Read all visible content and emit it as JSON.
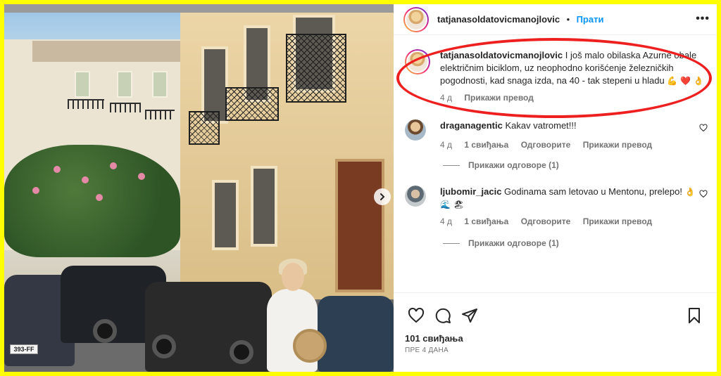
{
  "post": {
    "author": "tatjanasoldatovicmanojlovic",
    "separator": "•",
    "follow_label": "Прати",
    "more_label": "•••",
    "caption": "I još malo obilaska Azurne obale električnim biciklom, uz neophodno korišćenje železničkih pogodnosti, kad snaga izda, na 40 - tak stepeni u hladu",
    "caption_emojis": "💪 ❤️ 👌",
    "caption_age": "4 д",
    "caption_translate": "Прикажи превод",
    "license_plate": "393-FF"
  },
  "comments": [
    {
      "user": "draganagentic",
      "text": "Kakav vatromet!!!",
      "emojis": "",
      "age": "4 д",
      "likes": "1 свиђања",
      "reply": "Одговорите",
      "translate": "Прикажи превод",
      "view_replies": "Прикажи одговоре (1)"
    },
    {
      "user": "ljubomir_jacic",
      "text": "Godinama sam letovao u Mentonu, prelepo!",
      "emojis": "👌 🌊 🏖",
      "age": "4 д",
      "likes": "1 свиђања",
      "reply": "Одговорите",
      "translate": "Прикажи превод",
      "view_replies": "Прикажи одговоре (1)"
    }
  ],
  "footer": {
    "likes": "101 свиђања",
    "posted": "ПРЕ 4 ДАНА"
  },
  "colors": {
    "accent": "#0095f6",
    "frame": "#ffff00",
    "annotation": "#ee1f1f",
    "muted": "#737373"
  },
  "icons": [
    "like-heart-icon",
    "comment-bubble-icon",
    "share-send-icon",
    "bookmark-icon",
    "more-options-icon",
    "carousel-next-icon"
  ]
}
